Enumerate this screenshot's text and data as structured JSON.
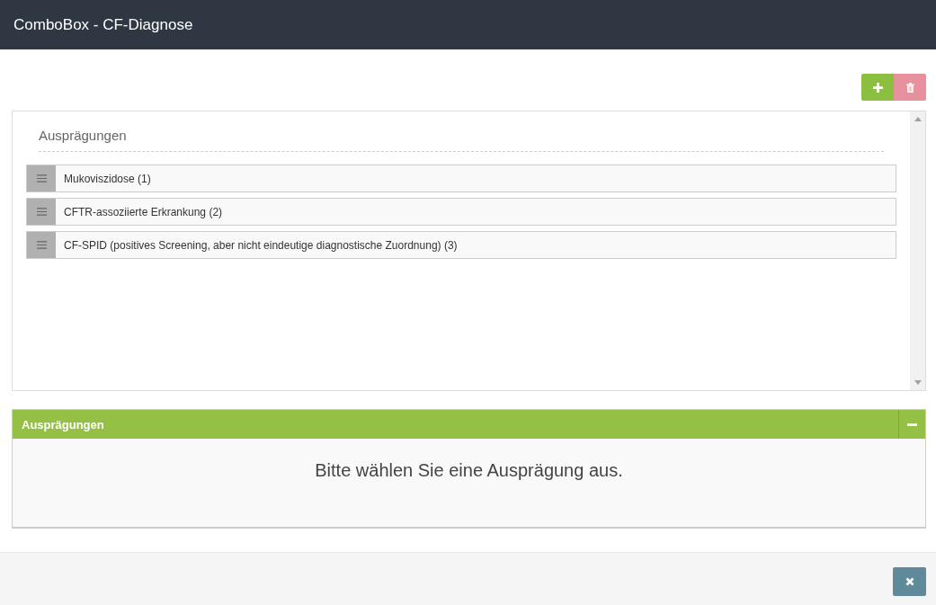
{
  "window": {
    "title": "ComboBox - CF-Diagnose"
  },
  "toolbar": {
    "buttons": [
      {
        "kind": "add",
        "disabled": false
      },
      {
        "kind": "delete",
        "disabled": true
      }
    ]
  },
  "list": {
    "heading": "Ausprägungen",
    "items": [
      {
        "label": "Mukoviszidose (1)"
      },
      {
        "label": "CFTR-assoziierte Erkrankung (2)"
      },
      {
        "label": "CF-SPID (positives Screening, aber nicht eindeutige diagnostische Zuordnung) (3)"
      }
    ]
  },
  "section": {
    "title": "Ausprägungen",
    "expanded": true,
    "message": "Bitte wählen Sie eine Ausprägung aus."
  },
  "footer": {
    "buttons": [
      {
        "kind": "close",
        "disabled": false
      }
    ]
  }
}
